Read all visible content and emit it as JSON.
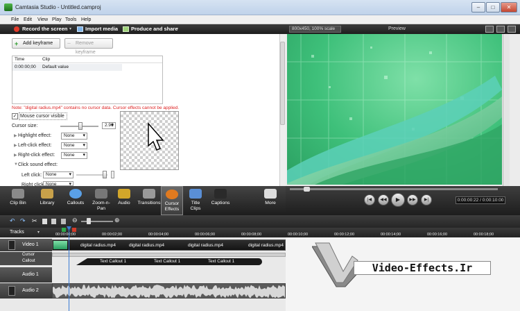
{
  "window": {
    "title": "Camtasia Studio - Untitled.camproj",
    "controls": {
      "minimize": "–",
      "maximize": "□",
      "close": "✕"
    }
  },
  "menu": [
    "File",
    "Edit",
    "View",
    "Play",
    "Tools",
    "Help"
  ],
  "toolbar": {
    "record": "Record the screen",
    "import": "Import media",
    "produce": "Produce and share"
  },
  "preview": {
    "zoom": "800x450, 100% scale",
    "label": "Preview",
    "time": "0:00:00:22 / 0:00:10:00"
  },
  "keyframes": {
    "add": "Add keyframe",
    "remove": "Remove keyframe",
    "headers": [
      "Time",
      "Clip"
    ],
    "rows": [
      [
        "0:00:00;00",
        "Default value"
      ]
    ]
  },
  "warning": "Note: \"digital radius.mp4\" contains no cursor data. Cursor effects cannot be applied.",
  "cursor": {
    "visible_label": "Mouse cursor visible",
    "visible": true,
    "size_label": "Cursor size:",
    "size_value": "2.96",
    "size_level": 0.5,
    "highlight_label": "Highlight effect:",
    "highlight_value": "None",
    "left_click_label": "Left-click effect:",
    "left_click_value": "None",
    "right_click_label": "Right-click effect:",
    "right_click_value": "None",
    "sound_label": "Click sound effect:",
    "sound_left_label": "Left click:",
    "sound_left_value": "None",
    "sound_right_label": "Right click:",
    "sound_right_value": "None"
  },
  "tabs": [
    {
      "label": "Clip Bin",
      "icon": "clip-bin-icon",
      "color": "#8a8a8a"
    },
    {
      "label": "Library",
      "icon": "library-icon",
      "color": "#c8a14a"
    },
    {
      "label": "Callouts",
      "icon": "callouts-icon",
      "color": "#5aa0e6"
    },
    {
      "label": "Zoom-n-\nPan",
      "icon": "zoom-n-pan-icon",
      "color": "#777777"
    },
    {
      "label": "Audio",
      "icon": "audio-icon",
      "color": "#d2a62a"
    },
    {
      "label": "Transitions",
      "icon": "transitions-icon",
      "color": "#9a9a9a"
    },
    {
      "label": "Cursor\nEffects",
      "icon": "cursor-effects-icon",
      "color": "#e07a1f",
      "active": true
    },
    {
      "label": "Title\nClips",
      "icon": "title-clips-icon",
      "color": "#5a8fd6"
    },
    {
      "label": "Captions",
      "icon": "captions-icon",
      "color": "#2a2a2a"
    },
    {
      "label": "More",
      "icon": "more-icon",
      "color": "#dddddd"
    }
  ],
  "timeline": {
    "tracks_label": "Tracks",
    "ticks": [
      "00:00:00;00",
      "00:00:02;00",
      "00:00:04;00",
      "00:00:06;00",
      "00:00:08;00",
      "00:00:10;00",
      "00:00:12;00",
      "00:00:14;00",
      "00:00:16;00",
      "00:00:18;00"
    ],
    "video_track": "Video 1",
    "cursor_track": "Cursor",
    "callout_track": "Callout",
    "audio1": "Audio 1",
    "audio2": "Audio 2",
    "clip_name": "digital radius.mp4",
    "callout_name": "Text Callout 1"
  },
  "watermark": "Video-Effects.Ir"
}
